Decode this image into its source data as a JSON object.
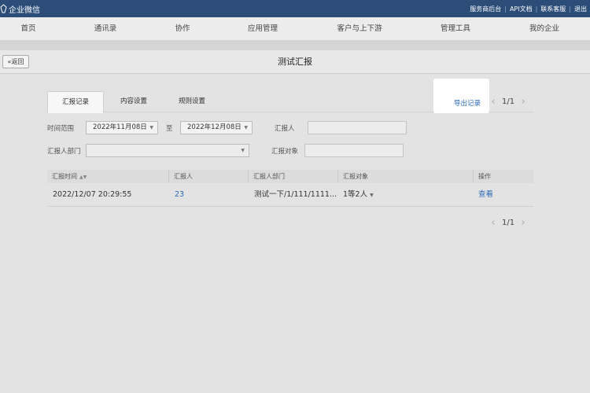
{
  "topbar": {
    "brand": "企业微信",
    "links": [
      "服务商后台",
      "API文档",
      "联系客服",
      "退出"
    ]
  },
  "nav": {
    "items": [
      "首页",
      "通讯录",
      "协作",
      "应用管理",
      "客户与上下游",
      "管理工具",
      "我的企业"
    ]
  },
  "page": {
    "back_label": "«返回",
    "title": "测试汇报"
  },
  "tabs": [
    "汇报记录",
    "内容设置",
    "规则设置"
  ],
  "export_label": "导出记录",
  "pager": {
    "prev": "‹",
    "next": "›",
    "page_text": "1/1"
  },
  "filters": {
    "time_range_label": "时间范围",
    "start_date": "2022年11月08日",
    "to_label": "至",
    "end_date": "2022年12月08日",
    "reporter_label": "汇报人",
    "reporter_dept_label": "汇报人部门",
    "report_target_label": "汇报对象"
  },
  "table": {
    "headers": [
      "汇报时间",
      "汇报人",
      "汇报人部门",
      "汇报对象",
      "操作"
    ],
    "rows": [
      {
        "time": "2022/12/07 20:29:55",
        "reporter": "23",
        "dept": "测试一下/1/111/1111...",
        "target": "1等2人",
        "action": "查看"
      }
    ]
  }
}
